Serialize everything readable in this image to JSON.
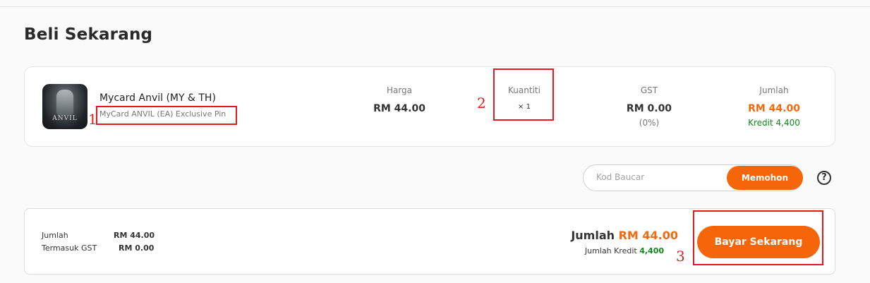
{
  "page": {
    "title": "Beli Sekarang"
  },
  "product": {
    "thumbnail_text": "ANVIL",
    "name": "Mycard Anvil (MY & TH)",
    "subtitle": "MyCard ANVIL (EA) Exclusive Pin",
    "price_label": "Harga",
    "price_value": "RM 44.00",
    "quantity_label": "Kuantiti",
    "quantity_value": "× 1",
    "gst_label": "GST",
    "gst_value": "RM 0.00",
    "gst_percent": "(0%)",
    "total_label": "Jumlah",
    "total_value": "RM 44.00",
    "credit_text": "Kredit 4,400"
  },
  "voucher": {
    "placeholder": "Kod Baucar",
    "apply_label": "Memohon",
    "help_symbol": "?"
  },
  "summary": {
    "amount_label": "Jumlah",
    "amount_value": "RM 44.00",
    "gst_label": "Termasuk GST",
    "gst_value": "RM 0.00",
    "grand_total_label": "Jumlah",
    "grand_total_value": "RM 44.00",
    "credit_label": "Jumlah Kredit",
    "credit_value": "4,400",
    "pay_label": "Bayar Sekarang"
  },
  "annotations": [
    "1",
    "2",
    "3"
  ],
  "colors": {
    "accent": "#f5660b",
    "credit": "#0f8a19",
    "annotation": "#e21b1b"
  }
}
